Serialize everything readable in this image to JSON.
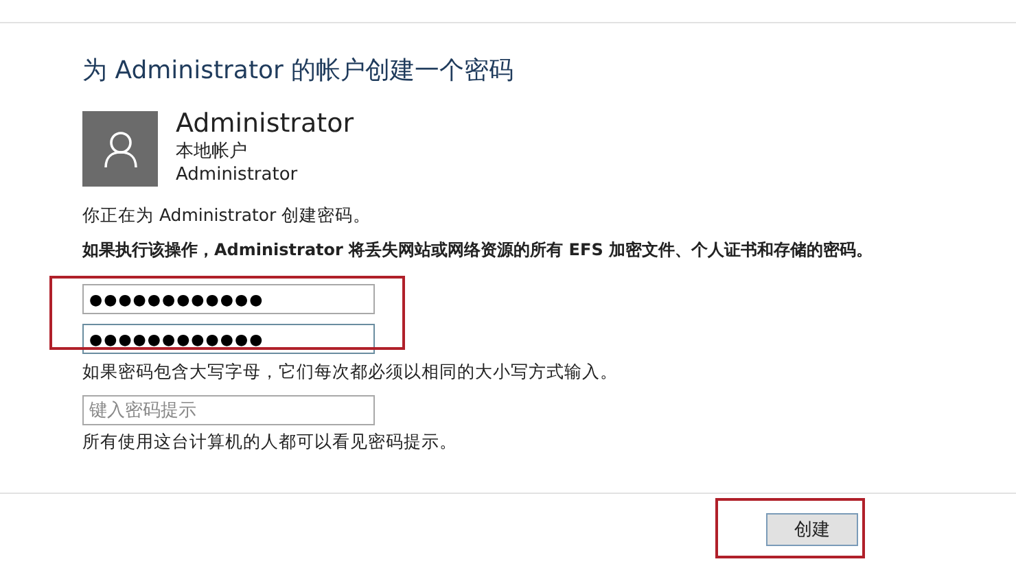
{
  "title": "为 Administrator 的帐户创建一个密码",
  "account": {
    "name": "Administrator",
    "type": "本地帐户",
    "username": "Administrator"
  },
  "intro": "你正在为 Administrator 创建密码。",
  "warning": "如果执行该操作，Administrator 将丢失网站或网络资源的所有 EFS 加密文件、个人证书和存储的密码。",
  "password_fields": [
    {
      "value": "●●●●●●●●●●●●",
      "focused": false
    },
    {
      "value": "●●●●●●●●●●●●",
      "focused": true
    }
  ],
  "case_note": "如果密码包含大写字母，它们每次都必须以相同的大小写方式输入。",
  "hint_field": {
    "placeholder": "键入密码提示"
  },
  "hint_note": "所有使用这台计算机的人都可以看见密码提示。",
  "button": "创建"
}
